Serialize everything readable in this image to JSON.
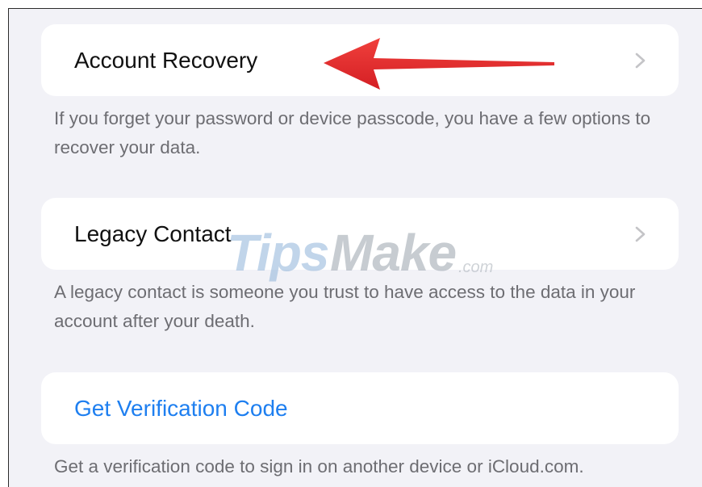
{
  "sections": [
    {
      "row_label": "Account Recovery",
      "has_chevron": true,
      "footer": "If you forget your password or device passcode, you have a few options to recover your data."
    },
    {
      "row_label": "Legacy Contact",
      "has_chevron": true,
      "footer": "A legacy contact is someone you trust to have access to the data in your account after your death."
    },
    {
      "row_label": "Get Verification Code",
      "has_chevron": false,
      "footer": "Get a verification code to sign in on another device or iCloud.com."
    }
  ],
  "watermark": {
    "brand": "TipsMake",
    "suffix": ".com"
  },
  "colors": {
    "background": "#f2f2f7",
    "cell": "#ffffff",
    "link": "#1e7ff0",
    "footer_text": "#6d6d72",
    "chevron": "#c4c4c7",
    "annotation_arrow": "#e8262b"
  },
  "icons": {
    "row_disclosure": "chevron-right-icon",
    "annotation": "red-arrow-annotation"
  }
}
